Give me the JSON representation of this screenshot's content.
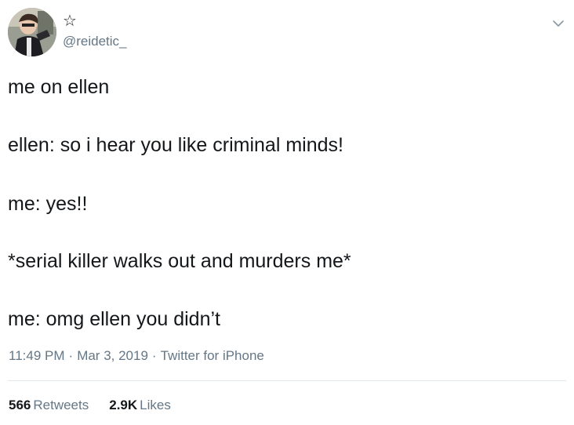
{
  "author": {
    "display_name": "☆",
    "handle": "@reidetic_"
  },
  "tweet": {
    "lines": [
      "me on ellen",
      "ellen: so i hear you like criminal minds!",
      "me: yes!!",
      "*serial killer walks out and murders me*",
      "me: omg ellen you didn’t"
    ]
  },
  "meta": {
    "time": "11:49 PM",
    "date": "Mar 3, 2019",
    "source": "Twitter for iPhone",
    "separator": "·"
  },
  "stats": {
    "retweets_count": "566",
    "retweets_label": "Retweets",
    "likes_count": "2.9K",
    "likes_label": "Likes"
  },
  "icons": {
    "menu": "chevron-down-icon"
  },
  "colors": {
    "text": "#14171a",
    "secondary": "#657786",
    "divider": "#e1e8ed"
  }
}
